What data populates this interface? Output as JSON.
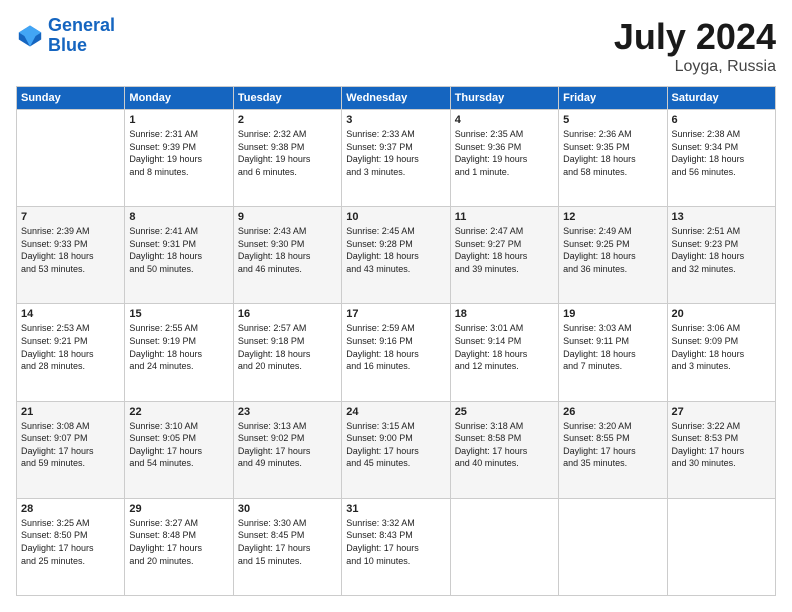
{
  "header": {
    "logo_line1": "General",
    "logo_line2": "Blue",
    "month_year": "July 2024",
    "location": "Loyga, Russia"
  },
  "days_of_week": [
    "Sunday",
    "Monday",
    "Tuesday",
    "Wednesday",
    "Thursday",
    "Friday",
    "Saturday"
  ],
  "weeks": [
    [
      {
        "day": "",
        "info": ""
      },
      {
        "day": "1",
        "info": "Sunrise: 2:31 AM\nSunset: 9:39 PM\nDaylight: 19 hours\nand 8 minutes."
      },
      {
        "day": "2",
        "info": "Sunrise: 2:32 AM\nSunset: 9:38 PM\nDaylight: 19 hours\nand 6 minutes."
      },
      {
        "day": "3",
        "info": "Sunrise: 2:33 AM\nSunset: 9:37 PM\nDaylight: 19 hours\nand 3 minutes."
      },
      {
        "day": "4",
        "info": "Sunrise: 2:35 AM\nSunset: 9:36 PM\nDaylight: 19 hours\nand 1 minute."
      },
      {
        "day": "5",
        "info": "Sunrise: 2:36 AM\nSunset: 9:35 PM\nDaylight: 18 hours\nand 58 minutes."
      },
      {
        "day": "6",
        "info": "Sunrise: 2:38 AM\nSunset: 9:34 PM\nDaylight: 18 hours\nand 56 minutes."
      }
    ],
    [
      {
        "day": "7",
        "info": "Sunrise: 2:39 AM\nSunset: 9:33 PM\nDaylight: 18 hours\nand 53 minutes."
      },
      {
        "day": "8",
        "info": "Sunrise: 2:41 AM\nSunset: 9:31 PM\nDaylight: 18 hours\nand 50 minutes."
      },
      {
        "day": "9",
        "info": "Sunrise: 2:43 AM\nSunset: 9:30 PM\nDaylight: 18 hours\nand 46 minutes."
      },
      {
        "day": "10",
        "info": "Sunrise: 2:45 AM\nSunset: 9:28 PM\nDaylight: 18 hours\nand 43 minutes."
      },
      {
        "day": "11",
        "info": "Sunrise: 2:47 AM\nSunset: 9:27 PM\nDaylight: 18 hours\nand 39 minutes."
      },
      {
        "day": "12",
        "info": "Sunrise: 2:49 AM\nSunset: 9:25 PM\nDaylight: 18 hours\nand 36 minutes."
      },
      {
        "day": "13",
        "info": "Sunrise: 2:51 AM\nSunset: 9:23 PM\nDaylight: 18 hours\nand 32 minutes."
      }
    ],
    [
      {
        "day": "14",
        "info": "Sunrise: 2:53 AM\nSunset: 9:21 PM\nDaylight: 18 hours\nand 28 minutes."
      },
      {
        "day": "15",
        "info": "Sunrise: 2:55 AM\nSunset: 9:19 PM\nDaylight: 18 hours\nand 24 minutes."
      },
      {
        "day": "16",
        "info": "Sunrise: 2:57 AM\nSunset: 9:18 PM\nDaylight: 18 hours\nand 20 minutes."
      },
      {
        "day": "17",
        "info": "Sunrise: 2:59 AM\nSunset: 9:16 PM\nDaylight: 18 hours\nand 16 minutes."
      },
      {
        "day": "18",
        "info": "Sunrise: 3:01 AM\nSunset: 9:14 PM\nDaylight: 18 hours\nand 12 minutes."
      },
      {
        "day": "19",
        "info": "Sunrise: 3:03 AM\nSunset: 9:11 PM\nDaylight: 18 hours\nand 7 minutes."
      },
      {
        "day": "20",
        "info": "Sunrise: 3:06 AM\nSunset: 9:09 PM\nDaylight: 18 hours\nand 3 minutes."
      }
    ],
    [
      {
        "day": "21",
        "info": "Sunrise: 3:08 AM\nSunset: 9:07 PM\nDaylight: 17 hours\nand 59 minutes."
      },
      {
        "day": "22",
        "info": "Sunrise: 3:10 AM\nSunset: 9:05 PM\nDaylight: 17 hours\nand 54 minutes."
      },
      {
        "day": "23",
        "info": "Sunrise: 3:13 AM\nSunset: 9:02 PM\nDaylight: 17 hours\nand 49 minutes."
      },
      {
        "day": "24",
        "info": "Sunrise: 3:15 AM\nSunset: 9:00 PM\nDaylight: 17 hours\nand 45 minutes."
      },
      {
        "day": "25",
        "info": "Sunrise: 3:18 AM\nSunset: 8:58 PM\nDaylight: 17 hours\nand 40 minutes."
      },
      {
        "day": "26",
        "info": "Sunrise: 3:20 AM\nSunset: 8:55 PM\nDaylight: 17 hours\nand 35 minutes."
      },
      {
        "day": "27",
        "info": "Sunrise: 3:22 AM\nSunset: 8:53 PM\nDaylight: 17 hours\nand 30 minutes."
      }
    ],
    [
      {
        "day": "28",
        "info": "Sunrise: 3:25 AM\nSunset: 8:50 PM\nDaylight: 17 hours\nand 25 minutes."
      },
      {
        "day": "29",
        "info": "Sunrise: 3:27 AM\nSunset: 8:48 PM\nDaylight: 17 hours\nand 20 minutes."
      },
      {
        "day": "30",
        "info": "Sunrise: 3:30 AM\nSunset: 8:45 PM\nDaylight: 17 hours\nand 15 minutes."
      },
      {
        "day": "31",
        "info": "Sunrise: 3:32 AM\nSunset: 8:43 PM\nDaylight: 17 hours\nand 10 minutes."
      },
      {
        "day": "",
        "info": ""
      },
      {
        "day": "",
        "info": ""
      },
      {
        "day": "",
        "info": ""
      }
    ]
  ]
}
